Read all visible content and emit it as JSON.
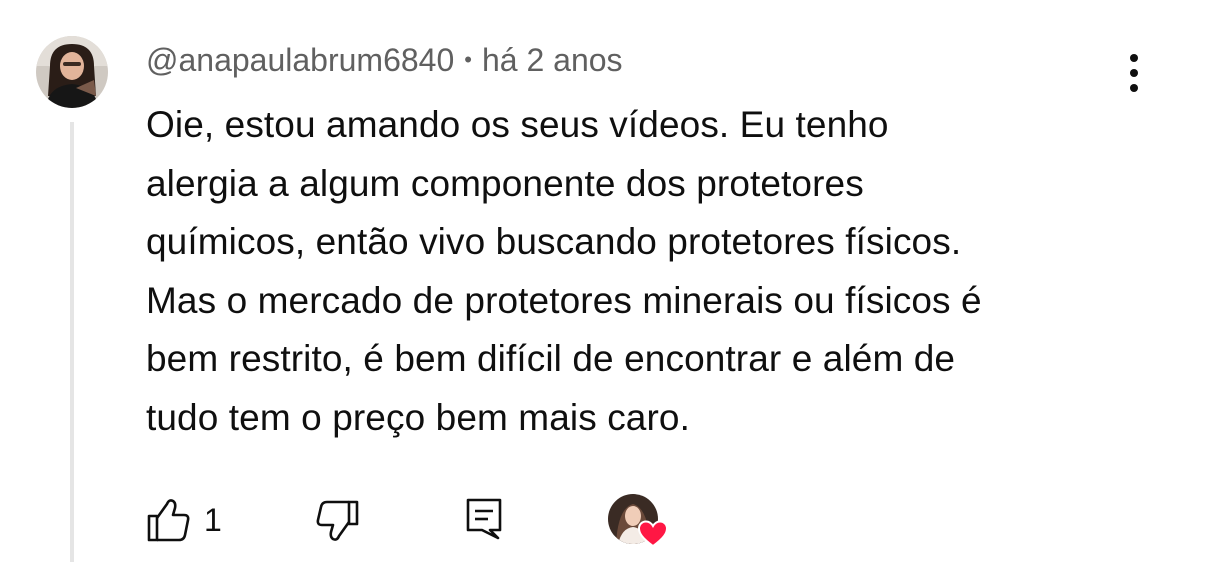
{
  "comment": {
    "author": "@anapaulabrum6840",
    "separator": "•",
    "time_ago": "há 2 anos",
    "text_lines": [
      "Oie, estou amando os seus vídeos. Eu tenho",
      "alergia a algum componente dos protetores",
      "químicos, então vivo buscando protetores físicos.",
      "Mas o mercado de protetores minerais ou físicos é",
      "bem restrito, é bem difícil de encontrar e além de",
      "tudo tem o preço bem mais caro."
    ],
    "like_count": "1"
  },
  "icons": {
    "more": "more-vertical-icon",
    "like": "thumbs-up-icon",
    "dislike": "thumbs-down-icon",
    "reply": "comment-icon",
    "heart": "heart-icon"
  },
  "colors": {
    "text": "#0f0f0f",
    "meta": "#606060",
    "thread_line": "#e5e5e5",
    "heart": "#ff1744"
  }
}
